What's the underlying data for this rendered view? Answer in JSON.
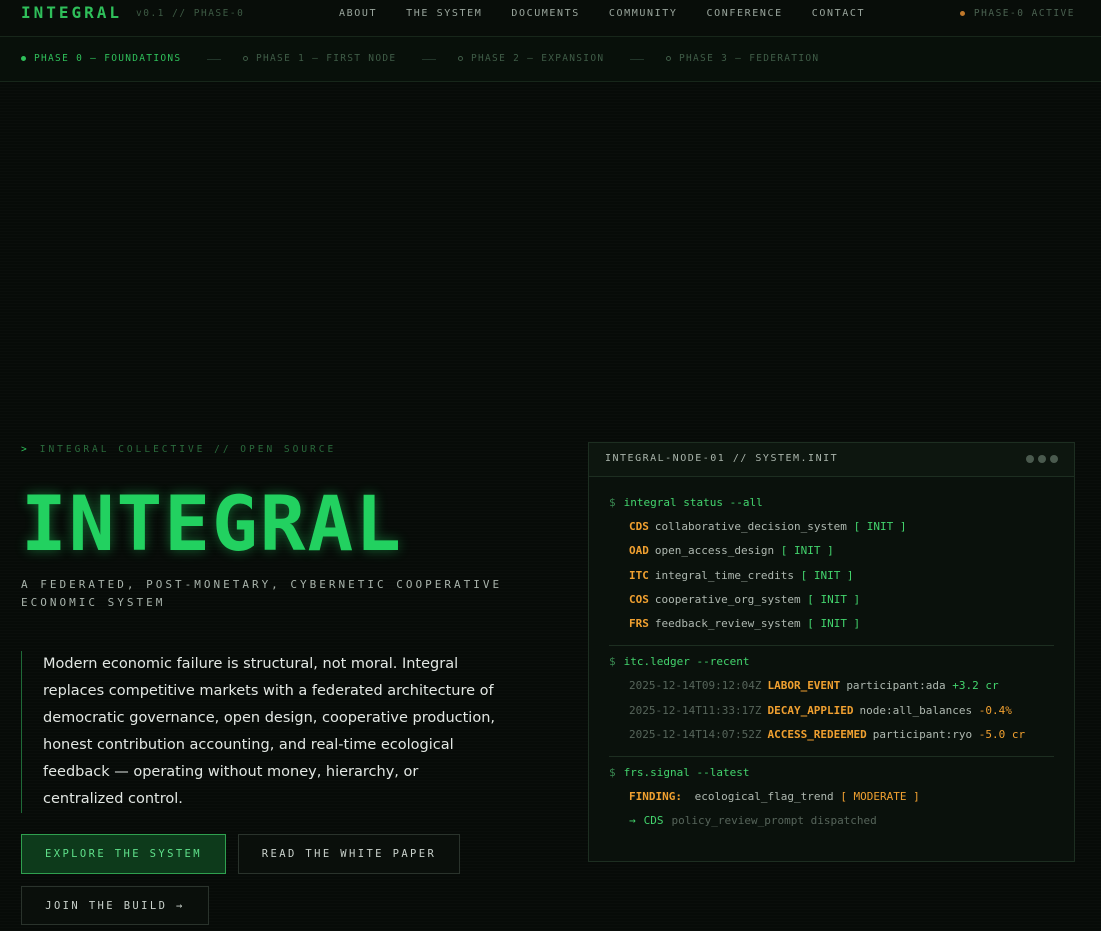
{
  "brand": {
    "logo": "INTEGRAL",
    "version": "v0.1 // PHASE-0",
    "status": "PHASE-0 ACTIVE",
    "status_color": "#c0782a"
  },
  "nav": {
    "items": [
      "ABOUT",
      "THE SYSTEM",
      "DOCUMENTS",
      "COMMUNITY",
      "CONFERENCE",
      "CONTACT"
    ]
  },
  "phases": [
    {
      "label": "PHASE 0 — FOUNDATIONS",
      "active": true
    },
    {
      "label": "PHASE 1 — FIRST NODE",
      "active": false
    },
    {
      "label": "PHASE 2 — EXPANSION",
      "active": false
    },
    {
      "label": "PHASE 3 — FEDERATION",
      "active": false
    }
  ],
  "hero": {
    "eyebrow_prefix": ">",
    "eyebrow": "INTEGRAL COLLECTIVE // OPEN SOURCE",
    "title": "INTEGRAL",
    "subtitle": "A FEDERATED, POST-MONETARY, CYBERNETIC COOPERATIVE ECONOMIC SYSTEM",
    "lede": "Modern economic failure is structural, not moral. Integral replaces competitive markets with a federated architecture of democratic governance, open design, cooperative production, honest contribution accounting, and real-time ecological feedback — operating without money, hierarchy, or centralized control.",
    "buttons": {
      "explore": "EXPLORE THE SYSTEM",
      "whitepaper": "READ THE WHITE PAPER",
      "join": "JOIN THE BUILD →"
    },
    "accent_color": "#22d160"
  },
  "terminal": {
    "title": "INTEGRAL-NODE-01 // SYSTEM.INIT",
    "prompt": "$",
    "cmd1": "integral status --all",
    "systems": [
      {
        "code": "CDS",
        "name": "collaborative_decision_system",
        "state": "[ INIT ]"
      },
      {
        "code": "OAD",
        "name": "open_access_design",
        "state": "[ INIT ]"
      },
      {
        "code": "ITC",
        "name": "integral_time_credits",
        "state": "[ INIT ]"
      },
      {
        "code": "COS",
        "name": "cooperative_org_system",
        "state": "[ INIT ]"
      },
      {
        "code": "FRS",
        "name": "feedback_review_system",
        "state": "[ INIT ]"
      }
    ],
    "cmd2": "itc.ledger --recent",
    "ledger": [
      {
        "ts": "2025-12-14T09:12:04Z",
        "event": "LABOR_EVENT",
        "subject": "participant:ada",
        "delta": "+3.2 cr"
      },
      {
        "ts": "2025-12-14T11:33:17Z",
        "event": "DECAY_APPLIED",
        "subject": "node:all_balances",
        "delta": "-0.4%"
      },
      {
        "ts": "2025-12-14T14:07:52Z",
        "event": "ACCESS_REDEEMED",
        "subject": "participant:ryo",
        "delta": "-5.0 cr"
      }
    ],
    "cmd3": "frs.signal --latest",
    "finding_label": "FINDING:",
    "finding_value": "ecological_flag_trend",
    "finding_level": "[ MODERATE ]",
    "dispatch_arrow": "→",
    "dispatch_target": "CDS",
    "dispatch_msg": "policy_review_prompt dispatched"
  }
}
